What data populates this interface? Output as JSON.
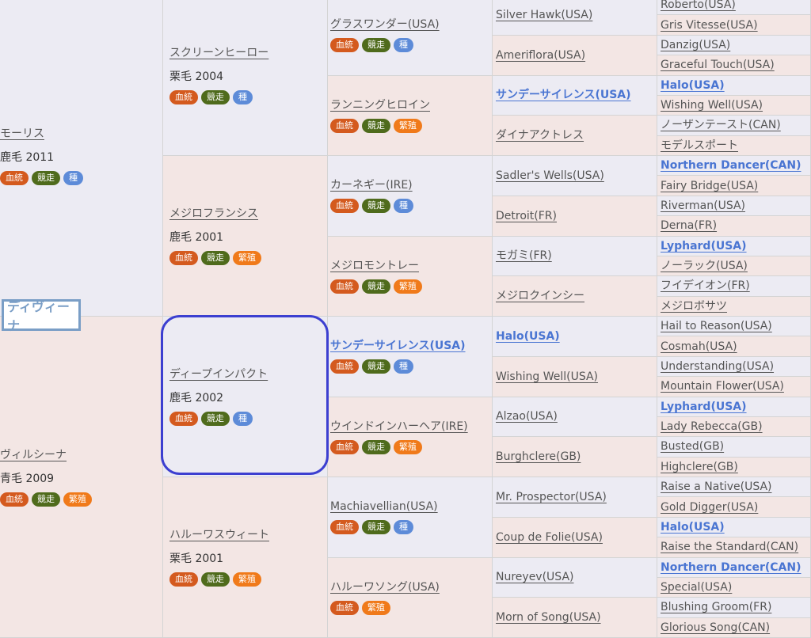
{
  "subject": {
    "name": "ディヴィーナ"
  },
  "tag_labels": {
    "blood": "血統",
    "race": "競走",
    "stud": "種",
    "breed": "繁殖"
  },
  "tag_colors": {
    "blood": "#d45a1e",
    "race": "#4f6b1c",
    "stud": "#5d8bd8",
    "breed": "#f07a1a"
  },
  "gen1": [
    {
      "name": "モーリス",
      "info": "鹿毛 2011",
      "tags": [
        "blood",
        "race",
        "stud"
      ],
      "sex": "male"
    },
    {
      "name": "ヴィルシーナ",
      "info": "青毛 2009",
      "tags": [
        "blood",
        "race",
        "breed"
      ],
      "sex": "female"
    }
  ],
  "gen2": [
    {
      "name": "スクリーンヒーロー",
      "info": "栗毛 2004",
      "tags": [
        "blood",
        "race",
        "stud"
      ],
      "sex": "male"
    },
    {
      "name": "メジロフランシス",
      "info": "鹿毛 2001",
      "tags": [
        "blood",
        "race",
        "breed"
      ],
      "sex": "female"
    },
    {
      "name": "ディープインパクト",
      "info": "鹿毛 2002",
      "tags": [
        "blood",
        "race",
        "stud"
      ],
      "sex": "male"
    },
    {
      "name": "ハルーワスウィート",
      "info": "栗毛 2001",
      "tags": [
        "blood",
        "race",
        "breed"
      ],
      "sex": "female"
    }
  ],
  "gen3": [
    {
      "name": "グラスワンダー(USA)",
      "tags": [
        "blood",
        "race",
        "stud"
      ],
      "sex": "male"
    },
    {
      "name": "ランニングヒロイン",
      "tags": [
        "blood",
        "race",
        "breed"
      ],
      "sex": "female"
    },
    {
      "name": "カーネギー(IRE)",
      "tags": [
        "blood",
        "race",
        "stud"
      ],
      "sex": "male"
    },
    {
      "name": "メジロモントレー",
      "tags": [
        "blood",
        "race",
        "breed"
      ],
      "sex": "female"
    },
    {
      "name": "サンデーサイレンス(USA)",
      "tags": [
        "blood",
        "race",
        "stud"
      ],
      "sex": "male",
      "emphasis": true
    },
    {
      "name": "ウインドインハーヘア(IRE)",
      "tags": [
        "blood",
        "race",
        "breed"
      ],
      "sex": "female"
    },
    {
      "name": "Machiavellian(USA)",
      "tags": [
        "blood",
        "race",
        "stud"
      ],
      "sex": "male"
    },
    {
      "name": "ハルーワソング(USA)",
      "tags": [
        "blood",
        "breed"
      ],
      "sex": "female"
    }
  ],
  "gen4": [
    {
      "name": "Silver Hawk(USA)",
      "sex": "male"
    },
    {
      "name": "Ameriflora(USA)",
      "sex": "female"
    },
    {
      "name": "サンデーサイレンス(USA)",
      "sex": "male",
      "emphasis": true
    },
    {
      "name": "ダイナアクトレス",
      "sex": "female"
    },
    {
      "name": "Sadler's Wells(USA)",
      "sex": "male"
    },
    {
      "name": "Detroit(FR)",
      "sex": "female"
    },
    {
      "name": "モガミ(FR)",
      "sex": "male"
    },
    {
      "name": "メジロクインシー",
      "sex": "female"
    },
    {
      "name": "Halo(USA)",
      "sex": "male",
      "emphasis": true
    },
    {
      "name": "Wishing Well(USA)",
      "sex": "female"
    },
    {
      "name": "Alzao(USA)",
      "sex": "male"
    },
    {
      "name": "Burghclere(GB)",
      "sex": "female"
    },
    {
      "name": "Mr. Prospector(USA)",
      "sex": "male"
    },
    {
      "name": "Coup de Folie(USA)",
      "sex": "female"
    },
    {
      "name": "Nureyev(USA)",
      "sex": "male"
    },
    {
      "name": "Morn of Song(USA)",
      "sex": "female"
    }
  ],
  "gen5": [
    {
      "name": "Roberto(USA)",
      "sex": "male"
    },
    {
      "name": "Gris Vitesse(USA)",
      "sex": "female"
    },
    {
      "name": "Danzig(USA)",
      "sex": "male"
    },
    {
      "name": "Graceful Touch(USA)",
      "sex": "female"
    },
    {
      "name": "Halo(USA)",
      "sex": "male",
      "emphasis": true
    },
    {
      "name": "Wishing Well(USA)",
      "sex": "female"
    },
    {
      "name": "ノーザンテースト(CAN)",
      "sex": "male"
    },
    {
      "name": "モデルスポート",
      "sex": "female"
    },
    {
      "name": "Northern Dancer(CAN)",
      "sex": "male",
      "emphasis": true
    },
    {
      "name": "Fairy Bridge(USA)",
      "sex": "female"
    },
    {
      "name": "Riverman(USA)",
      "sex": "male"
    },
    {
      "name": "Derna(FR)",
      "sex": "female"
    },
    {
      "name": "Lyphard(USA)",
      "sex": "male",
      "emphasis": true
    },
    {
      "name": "ノーラック(USA)",
      "sex": "female"
    },
    {
      "name": "フイデイオン(FR)",
      "sex": "male"
    },
    {
      "name": "メジロボサツ",
      "sex": "female"
    },
    {
      "name": "Hail to Reason(USA)",
      "sex": "male"
    },
    {
      "name": "Cosmah(USA)",
      "sex": "female"
    },
    {
      "name": "Understanding(USA)",
      "sex": "male"
    },
    {
      "name": "Mountain Flower(USA)",
      "sex": "female"
    },
    {
      "name": "Lyphard(USA)",
      "sex": "male",
      "emphasis": true
    },
    {
      "name": "Lady Rebecca(GB)",
      "sex": "female"
    },
    {
      "name": "Busted(GB)",
      "sex": "male"
    },
    {
      "name": "Highclere(GB)",
      "sex": "female"
    },
    {
      "name": "Raise a Native(USA)",
      "sex": "male"
    },
    {
      "name": "Gold Digger(USA)",
      "sex": "female"
    },
    {
      "name": "Halo(USA)",
      "sex": "male",
      "emphasis": true
    },
    {
      "name": "Raise the Standard(CAN)",
      "sex": "female"
    },
    {
      "name": "Northern Dancer(CAN)",
      "sex": "male",
      "emphasis": true
    },
    {
      "name": "Special(USA)",
      "sex": "female"
    },
    {
      "name": "Blushing Groom(FR)",
      "sex": "male"
    },
    {
      "name": "Glorious Song(CAN)",
      "sex": "female"
    }
  ]
}
